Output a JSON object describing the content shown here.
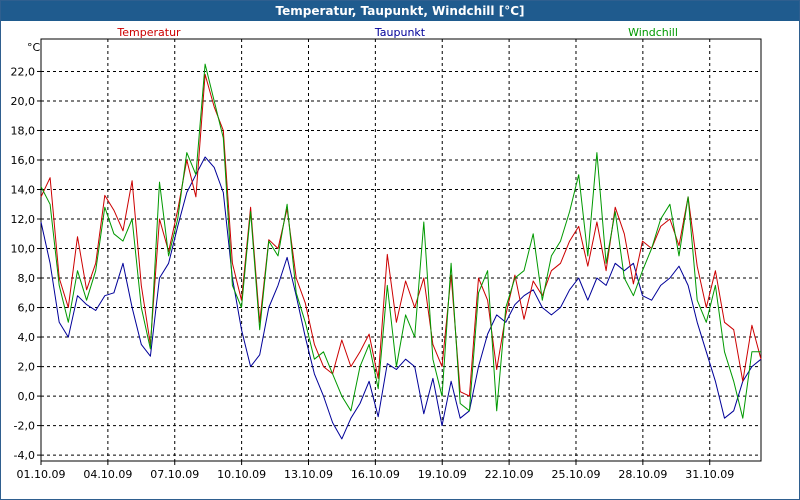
{
  "window": {
    "title": "Temperatur, Taupunkt, Windchill [°C]"
  },
  "chart_data": {
    "type": "line",
    "title": "Temperatur, Taupunkt, Windchill [°C]",
    "ylabel": "°C",
    "ylim": [
      -4.4,
      24.2
    ],
    "yticks": [
      -4,
      -2,
      0,
      2,
      4,
      6,
      8,
      10,
      12,
      14,
      16,
      18,
      20,
      22
    ],
    "ytick_labels": [
      "-4,0",
      "-2,0",
      "0,0",
      "2,0",
      "4,0",
      "6,0",
      "8,0",
      "10,0",
      "12,0",
      "14,0",
      "16,0",
      "18,0",
      "20,0",
      "22,0"
    ],
    "xlim": [
      1,
      33.3
    ],
    "xticks": [
      1,
      4,
      7,
      10,
      13,
      16,
      19,
      22,
      25,
      28,
      31
    ],
    "xtick_labels": [
      "01.10.09",
      "04.10.09",
      "07.10.09",
      "10.10.09",
      "13.10.09",
      "16.10.09",
      "19.10.09",
      "22.10.09",
      "25.10.09",
      "28.10.09",
      "31.10.09"
    ],
    "grid": true,
    "legend_position": "top",
    "x": [
      1.0,
      1.5,
      2.0,
      2.5,
      3.0,
      3.5,
      4.0,
      4.5,
      5.0,
      5.5,
      6.0,
      6.5,
      7.0,
      7.5,
      8.0,
      8.5,
      9.0,
      9.5,
      10.0,
      10.5,
      11.0,
      11.5,
      12.0,
      12.5,
      13.0,
      13.5,
      14.0,
      14.5,
      15.0,
      15.5,
      16.0,
      16.5,
      17.0,
      17.5,
      18.0,
      18.5,
      19.0,
      19.5,
      20.0,
      20.5,
      21.0,
      21.5,
      22.0,
      22.5,
      23.0,
      23.5,
      24.0,
      24.5,
      25.0,
      25.5,
      26.0,
      26.5,
      27.0,
      27.5,
      28.0,
      28.5,
      29.0,
      29.5,
      30.0,
      30.5,
      31.0,
      31.5,
      32.0,
      32.5,
      33.0,
      33.3
    ],
    "series": [
      {
        "name": "Temperatur",
        "color": "#cc0000",
        "values": [
          13.5,
          14.8,
          8.0,
          6.0,
          10.8,
          7.2,
          9.0,
          13.6,
          12.6,
          11.2,
          14.6,
          7.5,
          3.5,
          12.0,
          9.8,
          12.6,
          16.0,
          13.5,
          21.8,
          19.6,
          18.0,
          9.0,
          6.5,
          12.8,
          5.0,
          10.6,
          10.0,
          12.7,
          8.0,
          6.3,
          3.5,
          2.0,
          1.5,
          3.8,
          2.0,
          3.0,
          4.2,
          1.2,
          9.6,
          5.0,
          7.8,
          6.0,
          8.0,
          3.5,
          2.0,
          8.2,
          0.3,
          0.0,
          8.0,
          6.5,
          1.8,
          5.5,
          8.2,
          5.2,
          7.8,
          6.8,
          8.5,
          9.0,
          10.5,
          11.5,
          8.8,
          11.8,
          8.5,
          12.8,
          11.0,
          7.6,
          10.5,
          10.0,
          11.5,
          12.0,
          10.2,
          13.5,
          8.8,
          6.0,
          8.5,
          5.0,
          4.5,
          1.0,
          4.8,
          2.5
        ]
      },
      {
        "name": "Taupunkt",
        "color": "#000099",
        "values": [
          11.8,
          9.0,
          5.0,
          4.0,
          6.8,
          6.2,
          5.8,
          6.8,
          7.0,
          9.0,
          6.0,
          3.5,
          2.7,
          8.0,
          9.0,
          11.5,
          13.8,
          15.0,
          16.2,
          15.5,
          13.8,
          8.0,
          4.5,
          2.0,
          2.8,
          6.0,
          7.5,
          9.4,
          6.8,
          4.0,
          1.5,
          0.0,
          -1.8,
          -2.9,
          -1.5,
          -0.5,
          1.0,
          -1.4,
          2.2,
          1.8,
          2.5,
          2.0,
          -1.2,
          1.2,
          -2.0,
          1.0,
          -1.5,
          -1.0,
          2.0,
          4.2,
          5.5,
          5.0,
          6.2,
          6.8,
          7.2,
          6.0,
          5.5,
          6.0,
          7.2,
          8.0,
          6.5,
          8.0,
          7.5,
          9.0,
          8.5,
          9.0,
          6.8,
          6.5,
          7.5,
          8.0,
          8.8,
          7.5,
          5.0,
          3.0,
          1.0,
          -1.5,
          -1.0,
          1.0,
          2.0,
          2.5
        ]
      },
      {
        "name": "Windchill",
        "color": "#009900",
        "values": [
          14.2,
          13.0,
          7.5,
          5.0,
          8.5,
          6.5,
          8.5,
          12.8,
          11.0,
          10.5,
          12.0,
          6.0,
          3.2,
          14.5,
          9.5,
          12.0,
          16.5,
          15.0,
          22.5,
          20.0,
          17.5,
          7.5,
          6.0,
          12.5,
          4.5,
          10.5,
          9.5,
          13.0,
          7.0,
          5.0,
          2.5,
          3.0,
          1.5,
          0.0,
          -1.0,
          2.0,
          3.5,
          0.5,
          7.5,
          2.0,
          5.5,
          4.0,
          11.8,
          2.5,
          0.0,
          9.0,
          -0.5,
          -1.0,
          7.0,
          8.5,
          -1.0,
          6.0,
          8.0,
          8.5,
          11.0,
          6.5,
          9.5,
          10.5,
          12.5,
          15.0,
          9.5,
          16.5,
          9.0,
          12.5,
          8.0,
          6.8,
          8.5,
          10.0,
          12.0,
          13.0,
          9.5,
          13.5,
          6.5,
          5.0,
          7.5,
          3.0,
          1.0,
          -1.5,
          3.0,
          3.0
        ]
      }
    ]
  }
}
